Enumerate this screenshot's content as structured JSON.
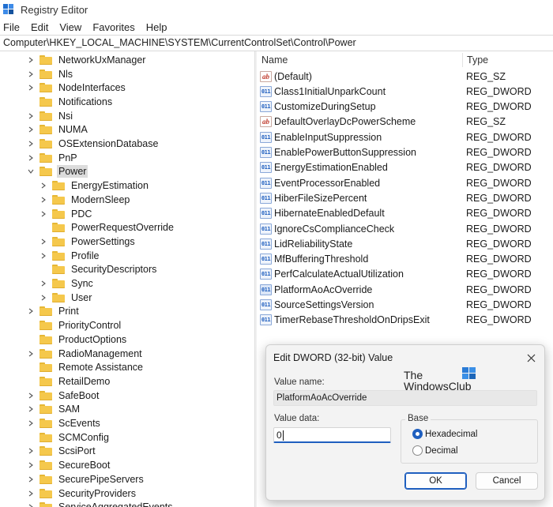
{
  "window": {
    "title": "Registry Editor"
  },
  "menu": [
    "File",
    "Edit",
    "View",
    "Favorites",
    "Help"
  ],
  "address": "Computer\\HKEY_LOCAL_MACHINE\\SYSTEM\\CurrentControlSet\\Control\\Power",
  "tree": [
    {
      "label": "NetworkUxManager",
      "level": 0,
      "expander": "collapsed"
    },
    {
      "label": "Nls",
      "level": 0,
      "expander": "collapsed"
    },
    {
      "label": "NodeInterfaces",
      "level": 0,
      "expander": "collapsed"
    },
    {
      "label": "Notifications",
      "level": 0,
      "expander": "none"
    },
    {
      "label": "Nsi",
      "level": 0,
      "expander": "collapsed"
    },
    {
      "label": "NUMA",
      "level": 0,
      "expander": "collapsed"
    },
    {
      "label": "OSExtensionDatabase",
      "level": 0,
      "expander": "collapsed"
    },
    {
      "label": "PnP",
      "level": 0,
      "expander": "collapsed"
    },
    {
      "label": "Power",
      "level": 0,
      "expander": "expanded",
      "selected": true
    },
    {
      "label": "EnergyEstimation",
      "level": 1,
      "expander": "collapsed"
    },
    {
      "label": "ModernSleep",
      "level": 1,
      "expander": "collapsed"
    },
    {
      "label": "PDC",
      "level": 1,
      "expander": "collapsed"
    },
    {
      "label": "PowerRequestOverride",
      "level": 1,
      "expander": "none"
    },
    {
      "label": "PowerSettings",
      "level": 1,
      "expander": "collapsed"
    },
    {
      "label": "Profile",
      "level": 1,
      "expander": "collapsed"
    },
    {
      "label": "SecurityDescriptors",
      "level": 1,
      "expander": "none"
    },
    {
      "label": "Sync",
      "level": 1,
      "expander": "collapsed"
    },
    {
      "label": "User",
      "level": 1,
      "expander": "collapsed"
    },
    {
      "label": "Print",
      "level": 0,
      "expander": "collapsed"
    },
    {
      "label": "PriorityControl",
      "level": 0,
      "expander": "none"
    },
    {
      "label": "ProductOptions",
      "level": 0,
      "expander": "none"
    },
    {
      "label": "RadioManagement",
      "level": 0,
      "expander": "collapsed"
    },
    {
      "label": "Remote Assistance",
      "level": 0,
      "expander": "none"
    },
    {
      "label": "RetailDemo",
      "level": 0,
      "expander": "none"
    },
    {
      "label": "SafeBoot",
      "level": 0,
      "expander": "collapsed"
    },
    {
      "label": "SAM",
      "level": 0,
      "expander": "collapsed"
    },
    {
      "label": "ScEvents",
      "level": 0,
      "expander": "collapsed"
    },
    {
      "label": "SCMConfig",
      "level": 0,
      "expander": "none"
    },
    {
      "label": "ScsiPort",
      "level": 0,
      "expander": "collapsed"
    },
    {
      "label": "SecureBoot",
      "level": 0,
      "expander": "collapsed"
    },
    {
      "label": "SecurePipeServers",
      "level": 0,
      "expander": "collapsed"
    },
    {
      "label": "SecurityProviders",
      "level": 0,
      "expander": "collapsed"
    },
    {
      "label": "ServiceAggregatedEvents",
      "level": 0,
      "expander": "collapsed"
    }
  ],
  "columns": {
    "name": "Name",
    "type": "Type"
  },
  "values": [
    {
      "name": "(Default)",
      "type": "REG_SZ",
      "icon": "sz"
    },
    {
      "name": "Class1InitialUnparkCount",
      "type": "REG_DWORD",
      "icon": "dword"
    },
    {
      "name": "CustomizeDuringSetup",
      "type": "REG_DWORD",
      "icon": "dword"
    },
    {
      "name": "DefaultOverlayDcPowerScheme",
      "type": "REG_SZ",
      "icon": "sz"
    },
    {
      "name": "EnableInputSuppression",
      "type": "REG_DWORD",
      "icon": "dword"
    },
    {
      "name": "EnablePowerButtonSuppression",
      "type": "REG_DWORD",
      "icon": "dword"
    },
    {
      "name": "EnergyEstimationEnabled",
      "type": "REG_DWORD",
      "icon": "dword"
    },
    {
      "name": "EventProcessorEnabled",
      "type": "REG_DWORD",
      "icon": "dword"
    },
    {
      "name": "HiberFileSizePercent",
      "type": "REG_DWORD",
      "icon": "dword"
    },
    {
      "name": "HibernateEnabledDefault",
      "type": "REG_DWORD",
      "icon": "dword"
    },
    {
      "name": "IgnoreCsComplianceCheck",
      "type": "REG_DWORD",
      "icon": "dword"
    },
    {
      "name": "LidReliabilityState",
      "type": "REG_DWORD",
      "icon": "dword"
    },
    {
      "name": "MfBufferingThreshold",
      "type": "REG_DWORD",
      "icon": "dword"
    },
    {
      "name": "PerfCalculateActualUtilization",
      "type": "REG_DWORD",
      "icon": "dword"
    },
    {
      "name": "PlatformAoAcOverride",
      "type": "REG_DWORD",
      "icon": "dword",
      "selected": true
    },
    {
      "name": "SourceSettingsVersion",
      "type": "REG_DWORD",
      "icon": "dword"
    },
    {
      "name": "TimerRebaseThresholdOnDripsExit",
      "type": "REG_DWORD",
      "icon": "dword"
    }
  ],
  "icon_text": {
    "sz": "ab",
    "dword": "011\n110"
  },
  "dialog": {
    "title": "Edit DWORD (32-bit) Value",
    "value_name_label": "Value name:",
    "value_name": "PlatformAoAcOverride",
    "value_data_label": "Value data:",
    "value_data": "0",
    "base_label": "Base",
    "base_options": [
      {
        "label": "Hexadecimal",
        "checked": true
      },
      {
        "label": "Decimal",
        "checked": false
      }
    ],
    "ok_label": "OK",
    "cancel_label": "Cancel",
    "watermark_line1": "The",
    "watermark_line2": "WindowsClub"
  },
  "colors": {
    "accent": "#1f5fbf",
    "folder": "#f5c84c",
    "selection": "#dcdcdc"
  }
}
